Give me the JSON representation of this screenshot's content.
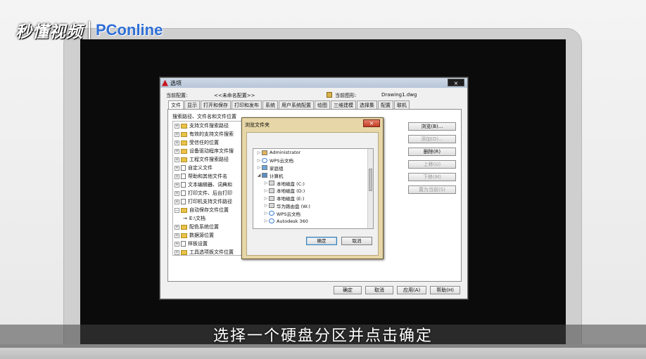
{
  "watermark": {
    "left": "秒懂视频",
    "right": "PConline"
  },
  "subtitle": "选择一个硬盘分区并点击确定",
  "options_dialog": {
    "title": "选项",
    "close_label": "×",
    "current_profile_label": "当前配置:",
    "current_profile_value": "<<未命名配置>>",
    "current_drawing_label": "当前图形:",
    "current_drawing_value": "Drawing1.dwg",
    "tabs": [
      "文件",
      "显示",
      "打开和保存",
      "打印和发布",
      "系统",
      "用户系统配置",
      "绘图",
      "三维建模",
      "选择集",
      "配置",
      "联机"
    ],
    "section_label": "搜索路径、文件名和文件位置",
    "tree": [
      {
        "label": "支持文件搜索路径",
        "icon": "folder"
      },
      {
        "label": "有效的支持文件搜索",
        "icon": "folder"
      },
      {
        "label": "受信任的位置",
        "icon": "folder"
      },
      {
        "label": "设备驱动程序文件搜",
        "icon": "folder"
      },
      {
        "label": "工程文件搜索路径",
        "icon": "folder"
      },
      {
        "label": "自定义文件",
        "icon": "doc"
      },
      {
        "label": "帮助和其他文件名",
        "icon": "doc"
      },
      {
        "label": "文本编辑器、词典和",
        "icon": "doc"
      },
      {
        "label": "打印文件、后台打印",
        "icon": "doc"
      },
      {
        "label": "打印机支持文件路径",
        "icon": "doc"
      },
      {
        "label": "自动保存文件位置",
        "icon": "folder"
      },
      {
        "label": "E:\\文档",
        "icon": "arrow"
      },
      {
        "label": "配色系统位置",
        "icon": "folder"
      },
      {
        "label": "数据源位置",
        "icon": "folder"
      },
      {
        "label": "样板设置",
        "icon": "doc"
      },
      {
        "label": "工具选项板文件位置",
        "icon": "folder"
      }
    ],
    "side_buttons": {
      "browse": "浏览(B)...",
      "add": "添加(D)...",
      "delete": "删除(R)",
      "move_up": "上移(U)",
      "move_down": "下移(M)",
      "set_current": "置为当前(S)"
    },
    "footer_buttons": {
      "ok": "确定",
      "cancel": "取消",
      "apply": "应用(A)",
      "help": "帮助(H)"
    }
  },
  "browse_dialog": {
    "title": "浏览文件夹",
    "close_label": "×",
    "items": [
      {
        "label": "Administrator",
        "icon": "user",
        "indent": 0,
        "expander": "▷"
      },
      {
        "label": "WPS云文档",
        "icon": "cloud",
        "indent": 0,
        "expander": "▷"
      },
      {
        "label": "家庭组",
        "icon": "net",
        "indent": 0,
        "expander": "▷"
      },
      {
        "label": "计算机",
        "icon": "pc",
        "indent": 0,
        "expander": "◢"
      },
      {
        "label": "本地磁盘 (C:)",
        "icon": "drive",
        "indent": 1,
        "expander": "▷"
      },
      {
        "label": "本地磁盘 (D:)",
        "icon": "drive",
        "indent": 1,
        "expander": "▷"
      },
      {
        "label": "本地磁盘 (E:)",
        "icon": "drive",
        "indent": 1,
        "expander": "▷"
      },
      {
        "label": "华为路由盘 (W:)",
        "icon": "drive",
        "indent": 1,
        "expander": "▷"
      },
      {
        "label": "WPS云文档",
        "icon": "cloud",
        "indent": 1,
        "expander": "▷"
      },
      {
        "label": "Autodesk 360",
        "icon": "cloud",
        "indent": 1,
        "expander": "▷"
      }
    ],
    "ok_label": "确定",
    "cancel_label": "取消"
  }
}
